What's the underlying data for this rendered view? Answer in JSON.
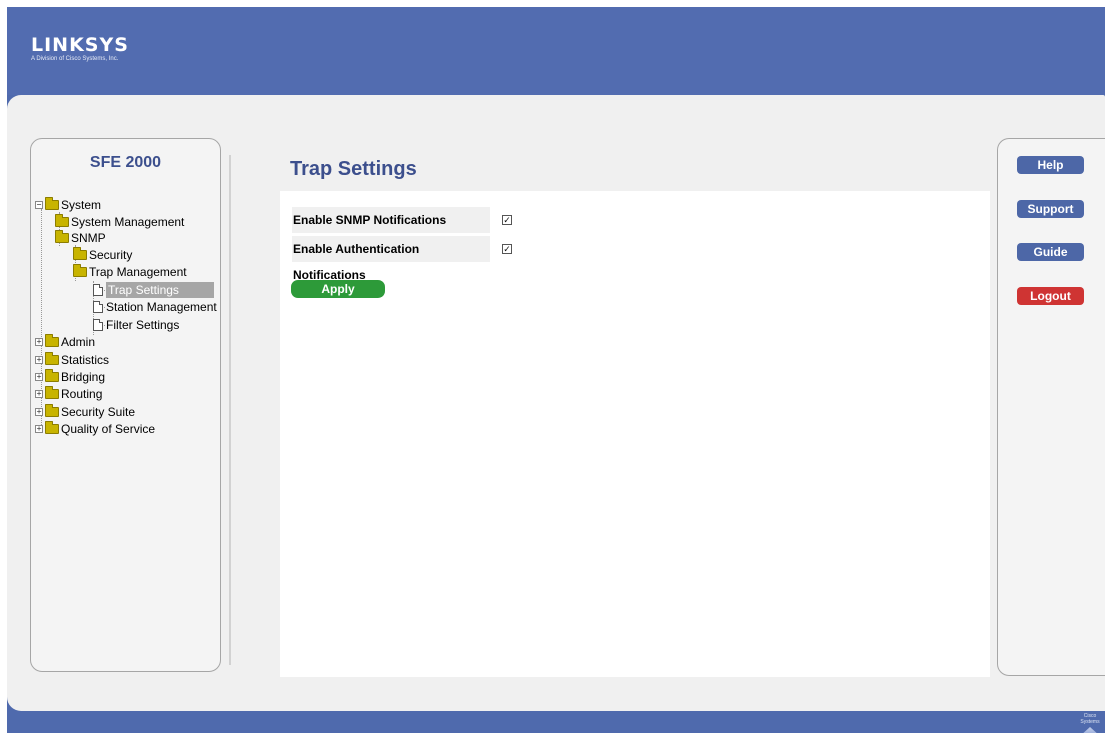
{
  "brand": {
    "name": "LINKSYS",
    "tagline": "A Division of Cisco Systems, Inc."
  },
  "device": {
    "model": "SFE 2000"
  },
  "tree": {
    "system": "System",
    "system_management": "System Management",
    "snmp": "SNMP",
    "security": "Security",
    "trap_management": "Trap Management",
    "trap_settings": "Trap Settings",
    "station_management": "Station Management",
    "filter_settings": "Filter Settings",
    "admin": "Admin",
    "statistics": "Statistics",
    "bridging": "Bridging",
    "routing": "Routing",
    "security_suite": "Security Suite",
    "quality_of_service": "Quality of Service"
  },
  "page": {
    "title": "Trap Settings",
    "fields": [
      {
        "label": "Enable SNMP Notifications",
        "checked": true
      },
      {
        "label": "Enable Authentication Notifications",
        "checked": true
      }
    ],
    "apply_label": "Apply"
  },
  "side_buttons": {
    "help": "Help",
    "support": "Support",
    "guide": "Guide",
    "logout": "Logout"
  },
  "footer": {
    "cisco_text": "Cisco Systems"
  },
  "colors": {
    "brand_blue": "#526cb0",
    "title_blue": "#3c4f8d",
    "apply_green": "#2d9a39",
    "logout_red": "#cf3433",
    "button_blue": "#4d67a7"
  }
}
